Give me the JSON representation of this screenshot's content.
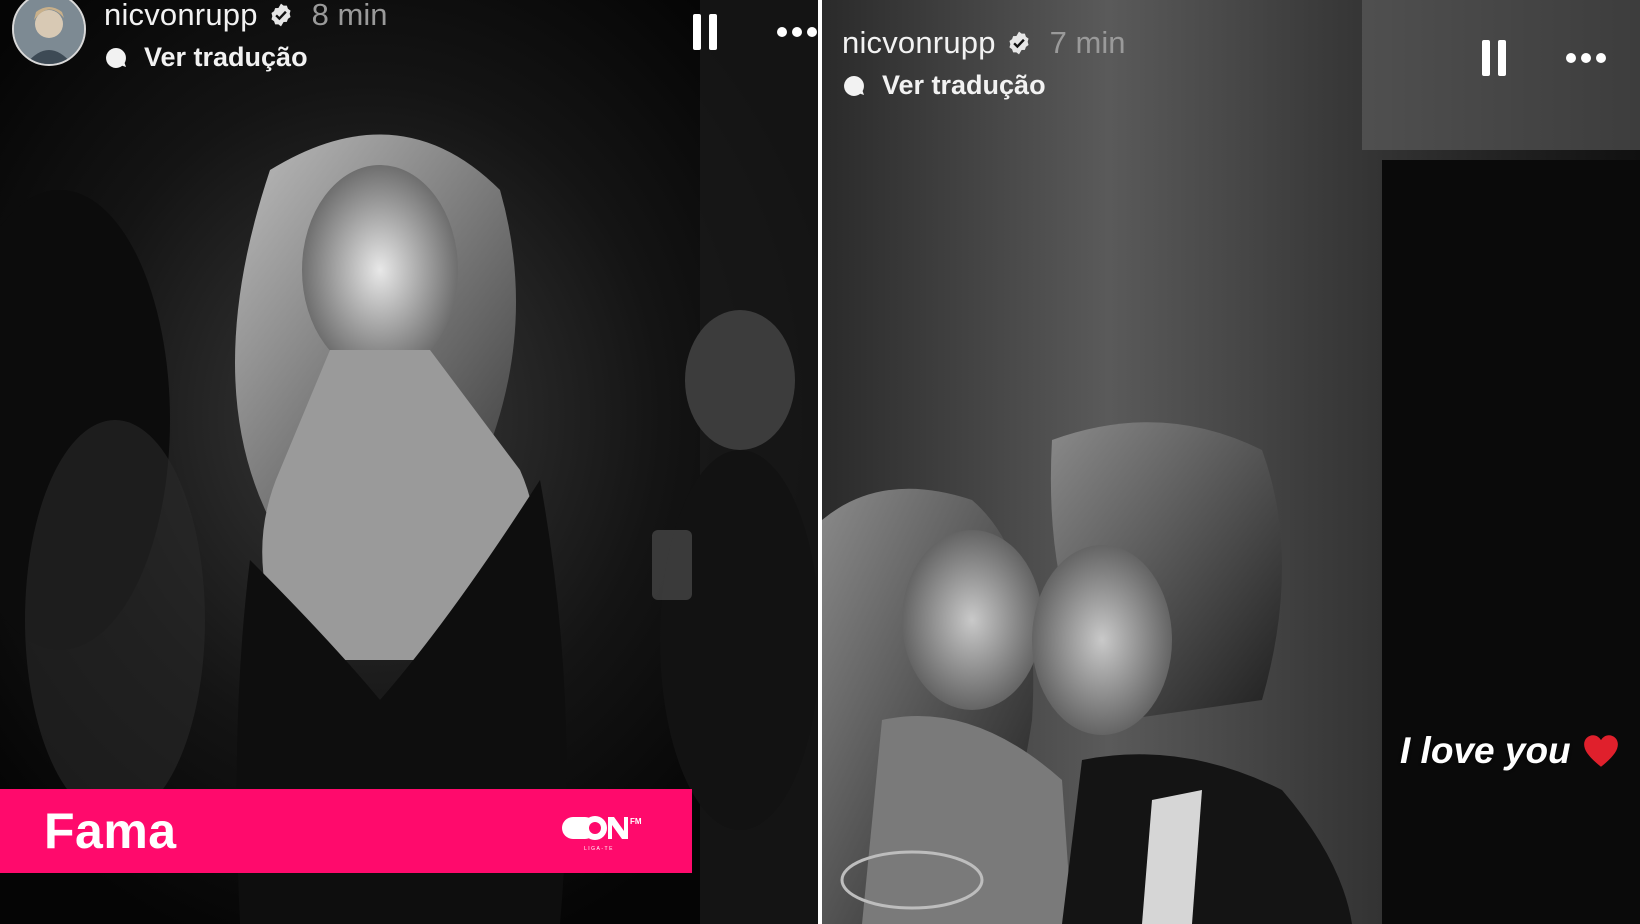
{
  "stories": [
    {
      "username": "nicvonrupp",
      "time": "8 min",
      "translate_label": "Ver tradução",
      "icons": [
        "avatar",
        "verified-badge-icon",
        "translate-bubble-icon",
        "pause-icon",
        "more-options-icon"
      ]
    },
    {
      "username": "nicvonrupp",
      "time": "7 min",
      "translate_label": "Ver tradução",
      "sticker_text": "I love you",
      "icons": [
        "verified-badge-icon",
        "translate-bubble-icon",
        "pause-icon",
        "more-options-icon",
        "heart-icon"
      ]
    }
  ],
  "banner": {
    "title": "Fama",
    "logo_text": "ON",
    "logo_superscript": "FM",
    "logo_tagline": "LIGA-TE"
  },
  "colors": {
    "banner": "#ff0a6c",
    "heart": "#e0202c",
    "background": "#000000",
    "text": "#ffffff",
    "timestamp": "#9a9a9a"
  }
}
